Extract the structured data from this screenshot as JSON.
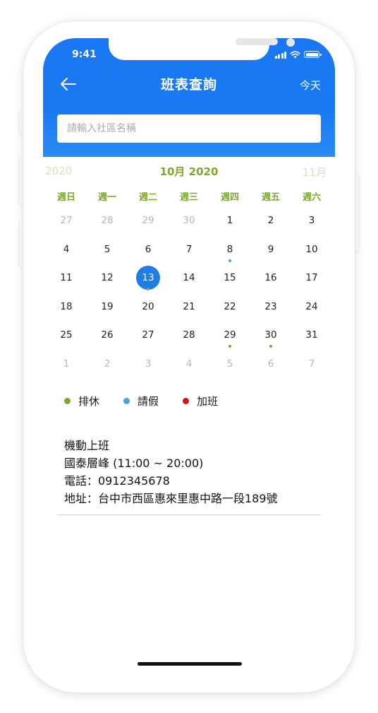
{
  "status_bar": {
    "time": "9:41"
  },
  "header": {
    "title": "班表查詢",
    "today_label": "今天",
    "search_placeholder": "請輸入社區名稱"
  },
  "calendar": {
    "prev_month": "2020",
    "current_month": "10月 2020",
    "next_month": "11月",
    "weekdays": [
      "週日",
      "週一",
      "週二",
      "週三",
      "週四",
      "週五",
      "週六"
    ],
    "weeks": [
      [
        {
          "d": "27",
          "muted": true
        },
        {
          "d": "28",
          "muted": true
        },
        {
          "d": "29",
          "muted": true
        },
        {
          "d": "30",
          "muted": true
        },
        {
          "d": "1"
        },
        {
          "d": "2"
        },
        {
          "d": "3"
        }
      ],
      [
        {
          "d": "4"
        },
        {
          "d": "5"
        },
        {
          "d": "6"
        },
        {
          "d": "7"
        },
        {
          "d": "8",
          "dot": "leave"
        },
        {
          "d": "9"
        },
        {
          "d": "10"
        }
      ],
      [
        {
          "d": "11"
        },
        {
          "d": "12"
        },
        {
          "d": "13",
          "selected": true,
          "dot": "rest"
        },
        {
          "d": "14"
        },
        {
          "d": "15"
        },
        {
          "d": "16"
        },
        {
          "d": "17"
        }
      ],
      [
        {
          "d": "18"
        },
        {
          "d": "19"
        },
        {
          "d": "20"
        },
        {
          "d": "21"
        },
        {
          "d": "22"
        },
        {
          "d": "23"
        },
        {
          "d": "24"
        }
      ],
      [
        {
          "d": "25"
        },
        {
          "d": "26"
        },
        {
          "d": "27"
        },
        {
          "d": "28"
        },
        {
          "d": "29",
          "dot": "rest"
        },
        {
          "d": "30",
          "dot": "rest"
        },
        {
          "d": "31"
        }
      ],
      [
        {
          "d": "1",
          "muted": true
        },
        {
          "d": "2",
          "muted": true
        },
        {
          "d": "3",
          "muted": true
        },
        {
          "d": "4",
          "muted": true
        },
        {
          "d": "5",
          "muted": true
        },
        {
          "d": "6",
          "muted": true
        },
        {
          "d": "7",
          "muted": true
        }
      ]
    ]
  },
  "legend": [
    {
      "key": "rest",
      "label": "排休",
      "color": "#7ca82c"
    },
    {
      "key": "leave",
      "label": "請假",
      "color": "#4aa3da"
    },
    {
      "key": "overtime",
      "label": "加班",
      "color": "#d0111b"
    }
  ],
  "detail": {
    "title": "機動上班",
    "location": "國泰層峰 (11:00 ~ 20:00)",
    "phone": "電話：0912345678",
    "address": "地址：台中市西區惠來里惠中路一段189號"
  },
  "colors": {
    "header_blue": "#1977f3",
    "accent_green": "#7ca82c",
    "selected_blue": "#1f7de6"
  }
}
